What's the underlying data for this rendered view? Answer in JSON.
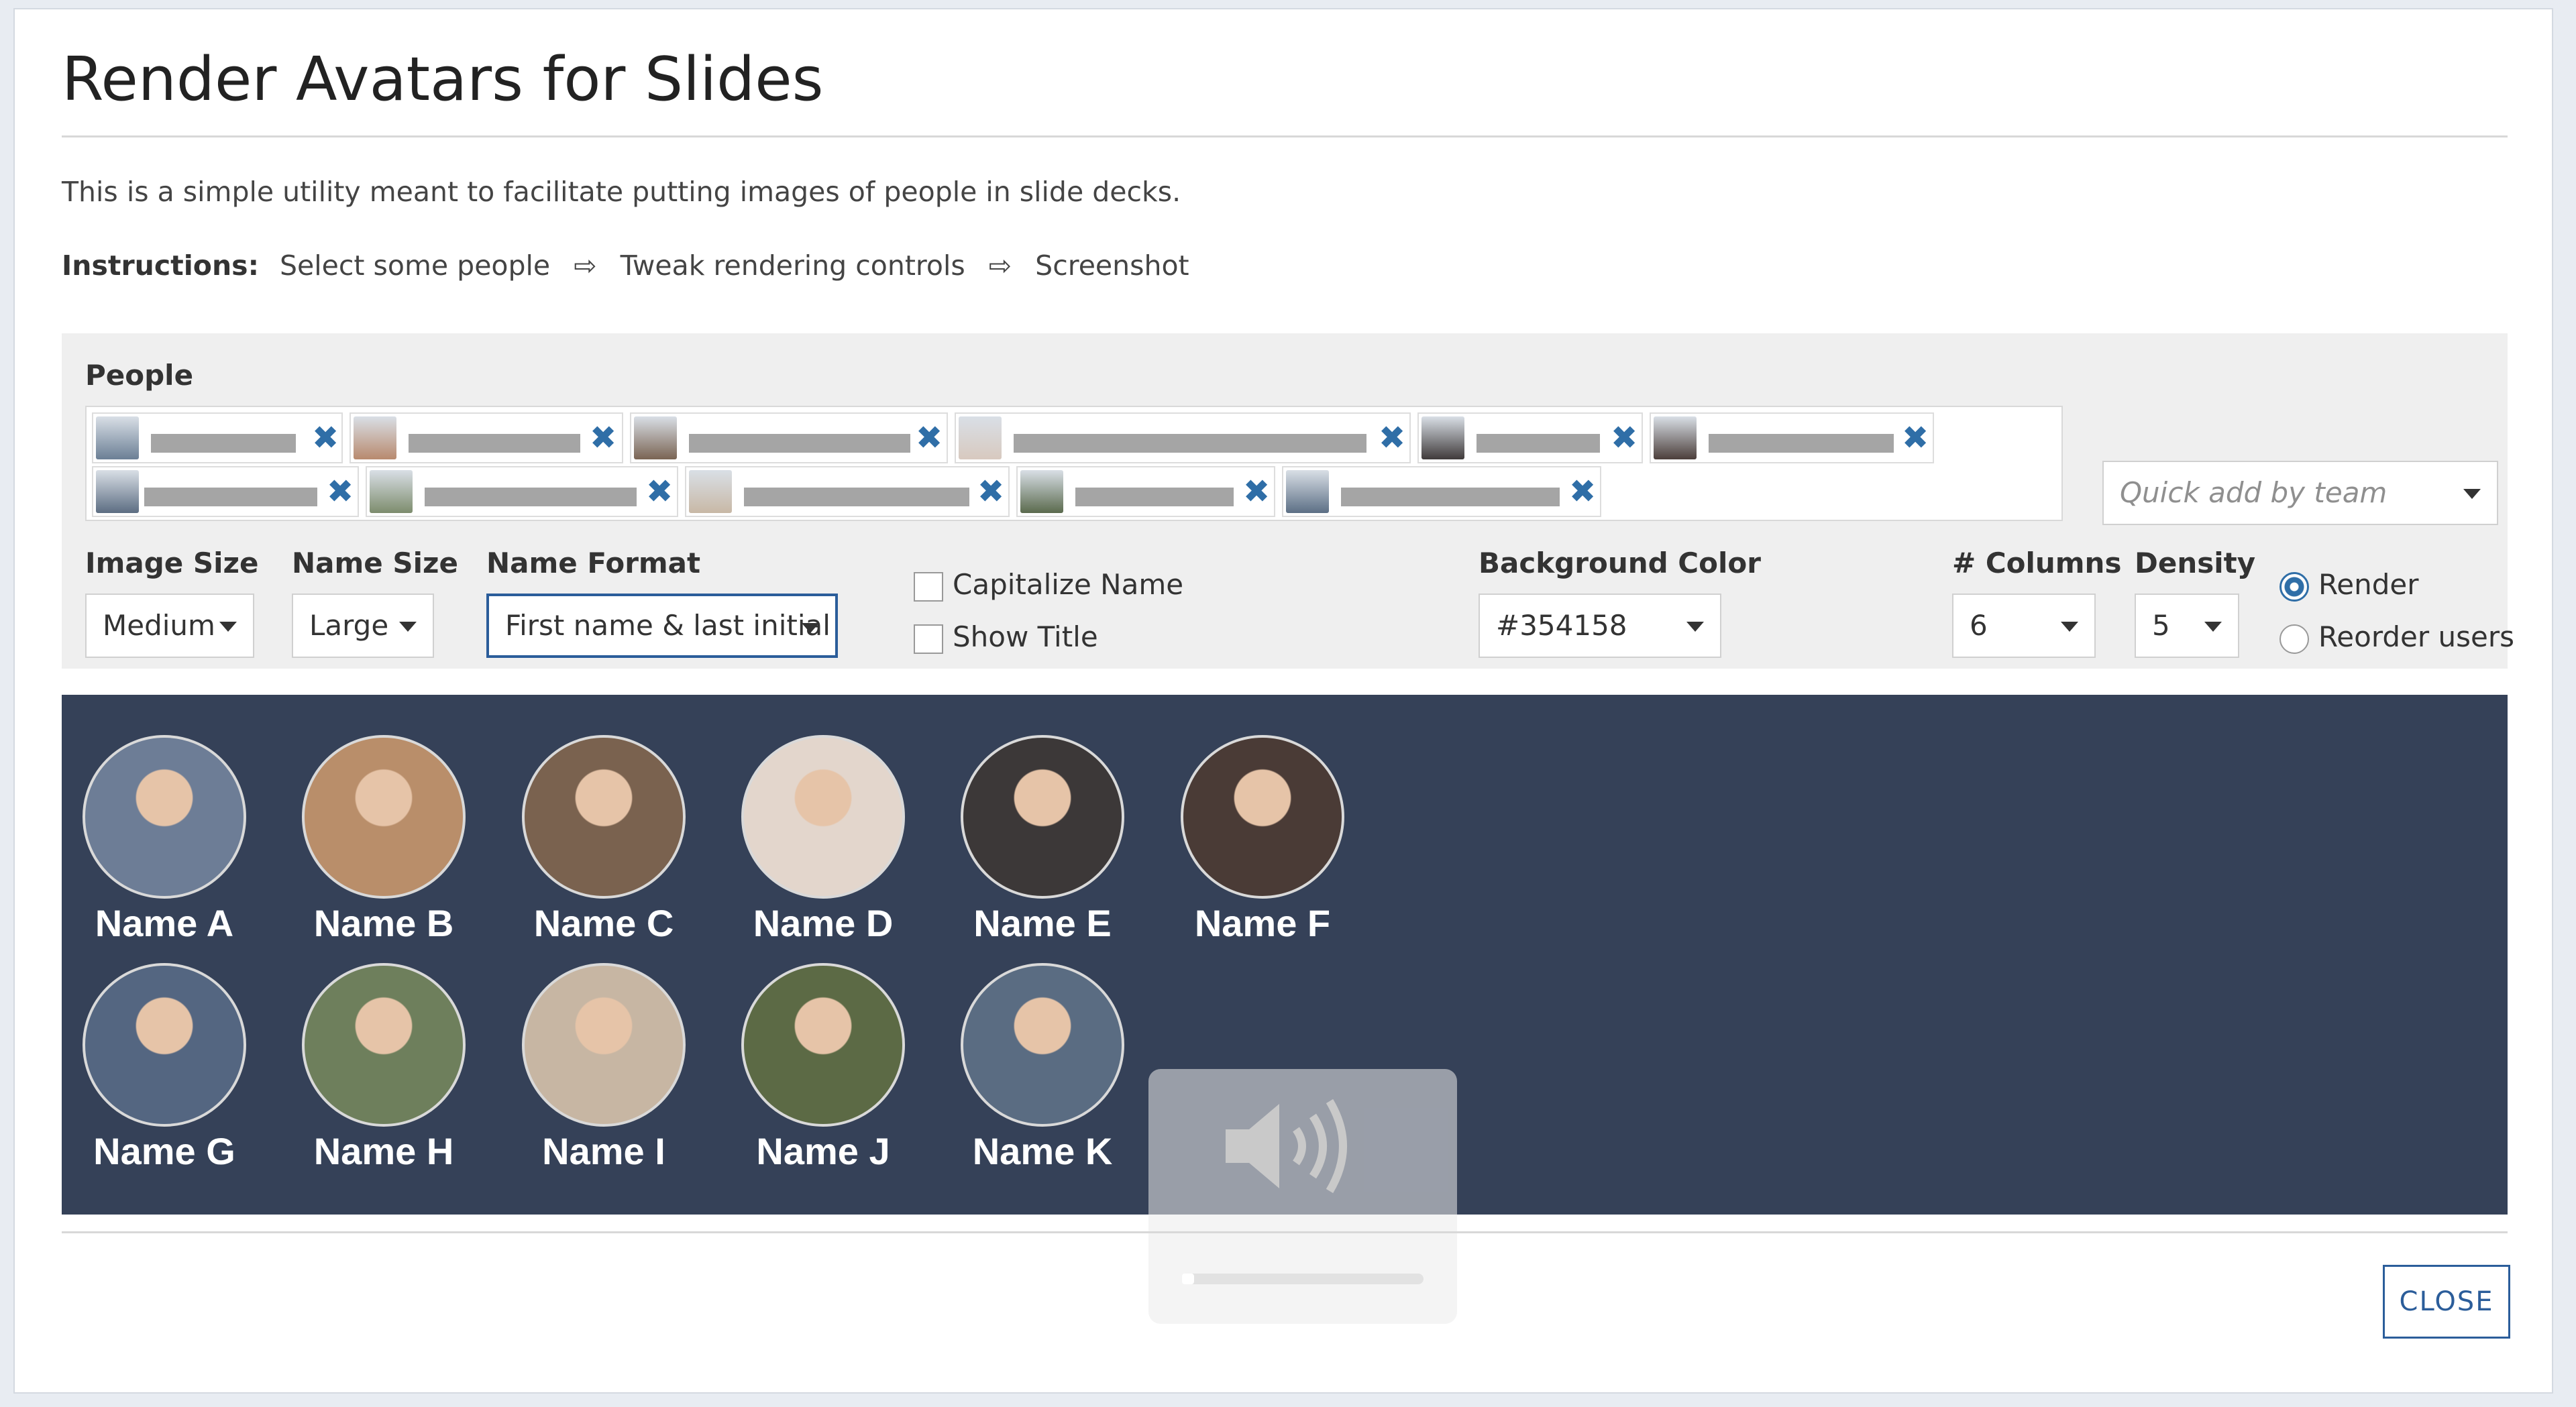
{
  "dialog": {
    "title": "Render Avatars for Slides",
    "description": "This is a simple utility meant to facilitate putting images of people in slide decks.",
    "instructions": {
      "label": "Instructions:",
      "steps": [
        "Select some people",
        "Tweak rendering controls",
        "Screenshot"
      ],
      "arrow": "⇨"
    },
    "close_label": "CLOSE"
  },
  "controls": {
    "people_label": "People",
    "quick_add_placeholder": "Quick add by team",
    "chip_remove_symbol": "✖",
    "chips": [
      {
        "color": "#6b7f95"
      },
      {
        "color": "#b88a6e"
      },
      {
        "color": "#7a6453"
      },
      {
        "color": "#d8c9bf"
      },
      {
        "color": "#3f3a3a"
      },
      {
        "color": "#4b3e3a"
      },
      {
        "color": "#5c6d82"
      },
      {
        "color": "#7d8c6d"
      },
      {
        "color": "#c8b8a6"
      },
      {
        "color": "#5a6a4d"
      },
      {
        "color": "#5c6f85"
      }
    ],
    "image_size": {
      "label": "Image Size",
      "value": "Medium"
    },
    "name_size": {
      "label": "Name Size",
      "value": "Large"
    },
    "name_format": {
      "label": "Name Format",
      "value": "First name & last initial"
    },
    "capitalize_name": {
      "label": "Capitalize Name",
      "checked": false
    },
    "show_title": {
      "label": "Show Title",
      "checked": false
    },
    "background_color": {
      "label": "Background Color",
      "value": "#354158"
    },
    "columns": {
      "label": "# Columns",
      "value": "6"
    },
    "density": {
      "label": "Density",
      "value": "5"
    },
    "mode": {
      "options": [
        "Render",
        "Reorder users"
      ],
      "selected": "Render"
    }
  },
  "preview": {
    "background": "#354158",
    "people": [
      {
        "name": "Name A",
        "color": "#6d7d96"
      },
      {
        "name": "Name B",
        "color": "#b98e6a"
      },
      {
        "name": "Name C",
        "color": "#7a624f"
      },
      {
        "name": "Name D",
        "color": "#e3d6cc"
      },
      {
        "name": "Name E",
        "color": "#3c3838"
      },
      {
        "name": "Name F",
        "color": "#4a3b36"
      },
      {
        "name": "Name G",
        "color": "#546681"
      },
      {
        "name": "Name H",
        "color": "#6e7f5c"
      },
      {
        "name": "Name I",
        "color": "#c7b6a3"
      },
      {
        "name": "Name J",
        "color": "#5c6a45"
      },
      {
        "name": "Name K",
        "color": "#5a6c82"
      }
    ]
  }
}
